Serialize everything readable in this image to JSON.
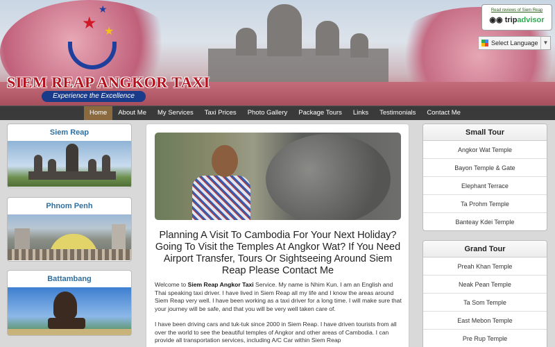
{
  "header": {
    "logo_title": "SIEM REAP ANGKOR TAXI",
    "logo_tagline": "Experience the Excellence",
    "tripadvisor_link": "Read reviews of Siem Reap",
    "tripadvisor_brand": "trip",
    "tripadvisor_brand_accent": "advisor",
    "language_select": "Select Language"
  },
  "nav": {
    "items": [
      {
        "label": "Home",
        "active": true
      },
      {
        "label": "About Me"
      },
      {
        "label": "My Services"
      },
      {
        "label": "Taxi Prices"
      },
      {
        "label": "Photo Gallery"
      },
      {
        "label": "Package Tours"
      },
      {
        "label": "Links"
      },
      {
        "label": "Testimonials"
      },
      {
        "label": "Contact Me"
      }
    ]
  },
  "destinations": [
    {
      "name": "Siem Reap"
    },
    {
      "name": "Phnom Penh"
    },
    {
      "name": "Battambang"
    }
  ],
  "main": {
    "headline": "Planning A Visit To Cambodia For Your Next Holiday? Going To Visit the Temples At Angkor Wat? If You Need Airport Transfer, Tours Or Sightseeing Around Siem Reap Please Contact Me",
    "para1_prefix": "Welcome to ",
    "para1_bold": "Siem Reap Angkor Taxi",
    "para1_rest": " Service. My name is Nhim Kun. I am an English and Thai speaking taxi driver. I have lived in Siem Reap all my life and I know the areas around Siem Reap very well. I have been working as a taxi driver for a long time. I will make sure that your journey will be safe, and that you will be very well taken care of.",
    "para2": "I have been driving cars and tuk-tuk since 2000 in Siem Reap. I have driven tourists from all over the world to see the beautiful temples of Angkor and other areas of Cambodia. I can provide all transportation services, including A/C Car within Siem Reap"
  },
  "small_tour": {
    "title": "Small Tour",
    "items": [
      "Angkor Wat Temple",
      "Bayon Temple & Gate",
      "Elephant Terrace",
      "Ta Prohm Temple",
      "Banteay Kdei Temple"
    ]
  },
  "grand_tour": {
    "title": "Grand Tour",
    "items": [
      "Preah Khan Temple",
      "Neak Pean Temple",
      "Ta Som Temple",
      "East Mebon Temple",
      "Pre Rup Temple"
    ]
  },
  "colors": {
    "nav_bg": "#3a3a3a",
    "nav_active": "#8b6a3f",
    "destination_title": "#2f6f9f",
    "logo_red": "#b3121e",
    "logo_blue": "#1a3a8a"
  }
}
